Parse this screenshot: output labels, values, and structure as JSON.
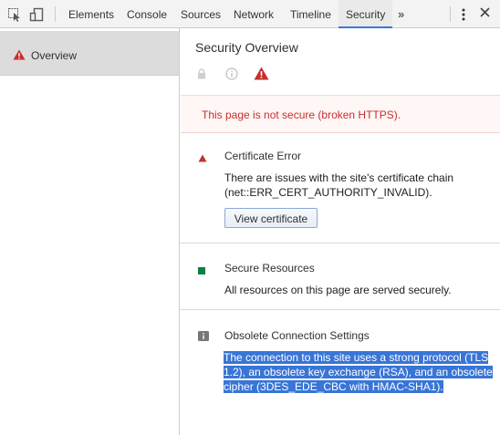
{
  "toolbar": {
    "tabs": [
      "Elements",
      "Console",
      "Sources",
      "Network",
      "Timeline",
      "Security"
    ],
    "active_tab": "Security",
    "overflow_label": "»"
  },
  "sidebar": {
    "items": [
      {
        "label": "Overview",
        "icon": "warning-icon"
      }
    ]
  },
  "main": {
    "title": "Security Overview",
    "banner": "This page is not secure (broken HTTPS).",
    "sections": {
      "certificate": {
        "title": "Certificate Error",
        "body_line1": "There are issues with the site's certificate chain",
        "body_line2": "(net::ERR_CERT_AUTHORITY_INVALID).",
        "button": "View certificate"
      },
      "resources": {
        "title": "Secure Resources",
        "body": "All resources on this page are served securely."
      },
      "connection": {
        "title": "Obsolete Connection Settings",
        "body_line1": "The connection to this site uses a strong protocol (TLS",
        "body_line2": "1.2), an obsolete key exchange (RSA), and an obsolete",
        "body_line3": "cipher (3DES_EDE_CBC with HMAC-SHA1)."
      }
    }
  },
  "colors": {
    "accent": "#3879d9",
    "error_red": "#c5302c",
    "secure_green": "#0b8043",
    "selection": "#3875d7"
  }
}
